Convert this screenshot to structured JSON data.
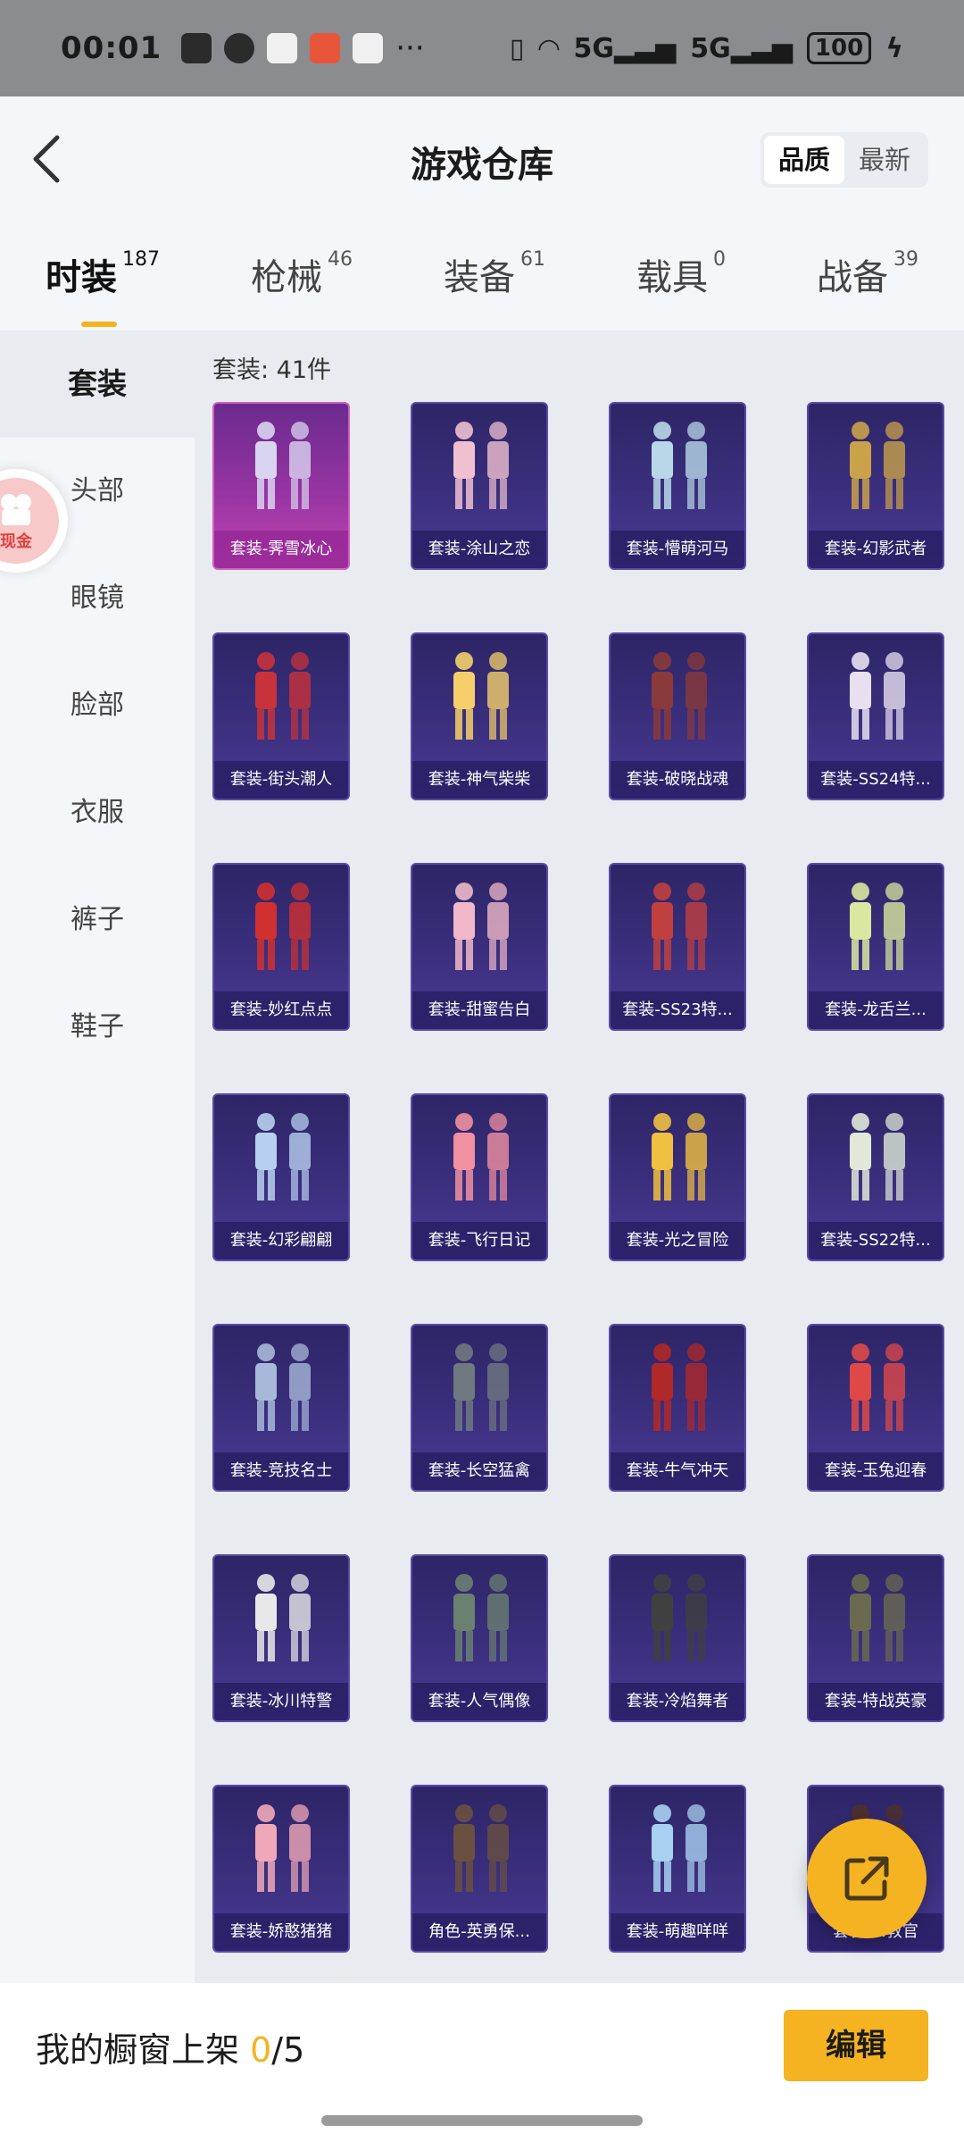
{
  "status_bar": {
    "time": "00:01",
    "signal_1": "5G",
    "signal_2": "5G",
    "battery": "100"
  },
  "header": {
    "title": "游戏仓库",
    "sort_options": [
      "品质",
      "最新"
    ],
    "active_sort": "品质"
  },
  "category_tabs": [
    {
      "label": "时装",
      "count": "187",
      "active": true
    },
    {
      "label": "枪械",
      "count": "46",
      "active": false
    },
    {
      "label": "装备",
      "count": "61",
      "active": false
    },
    {
      "label": "载具",
      "count": "0",
      "active": false
    },
    {
      "label": "战备",
      "count": "39",
      "active": false
    }
  ],
  "sidebar": {
    "items": [
      "套装",
      "头部",
      "眼镜",
      "脸部",
      "衣服",
      "裤子",
      "鞋子"
    ],
    "active": "套装",
    "badge_text": "现金"
  },
  "main": {
    "count_label": "套装: 41件",
    "items": [
      "套装-霁雪冰心",
      "套装-涂山之恋",
      "套装-懵萌河马",
      "套装-幻影武者",
      "套装-街头潮人",
      "套装-神气柴柴",
      "套装-破晓战魂",
      "套装-SS24特...",
      "套装-妙红点点",
      "套装-甜蜜告白",
      "套装-SS23特...",
      "套装-龙舌兰...",
      "套装-幻彩翩翩",
      "套装-飞行日记",
      "套装-光之冒险",
      "套装-SS22特...",
      "套装-竞技名士",
      "套装-长空猛禽",
      "套装-牛气冲天",
      "套装-玉兔迎春",
      "套装-冰川特警",
      "套装-人气偶像",
      "套装-冷焰舞者",
      "套装-特战英豪",
      "套装-娇憨猪猪",
      "角色-英勇保...",
      "套装-萌趣咩咩",
      "套装-...教官"
    ],
    "legendary_index": 0
  },
  "bottom_bar": {
    "showcase_label": "我的橱窗上架",
    "showcase_current": "0",
    "showcase_total": "/5",
    "edit_label": "编辑"
  },
  "colors": {
    "accent": "#f5b321",
    "card_bg": "#3b2f7e",
    "legend_bg": "#9c36a4"
  }
}
